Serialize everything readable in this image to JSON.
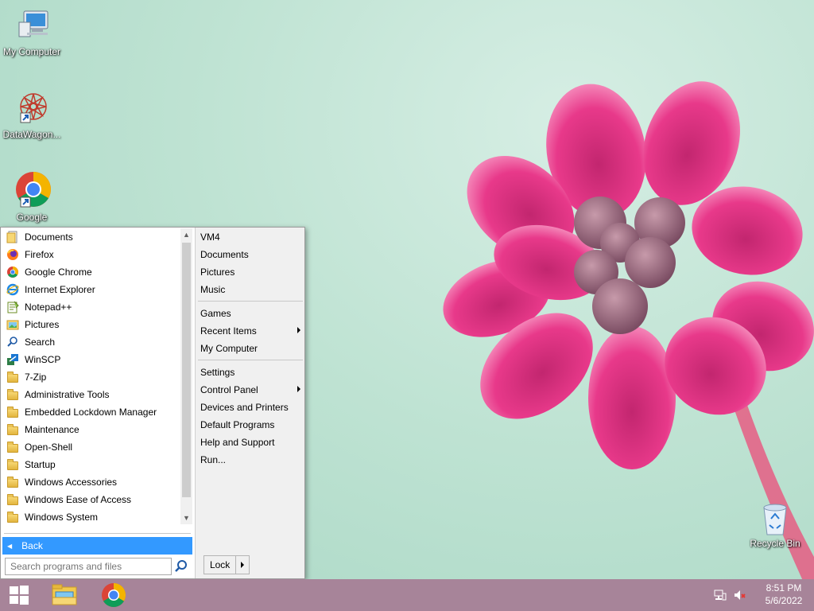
{
  "desktop": {
    "icons": [
      {
        "label": "My Computer",
        "icon": "computer-icon"
      },
      {
        "label": "DataWagon...",
        "icon": "datawagon-icon"
      },
      {
        "label": "Google",
        "icon": "chrome-icon"
      },
      {
        "label": "Recycle Bin",
        "icon": "recycle-bin-icon"
      }
    ]
  },
  "start_menu": {
    "programs": [
      {
        "label": "Documents",
        "icon": "documents-icon"
      },
      {
        "label": "Firefox",
        "icon": "firefox-icon"
      },
      {
        "label": "Google Chrome",
        "icon": "chrome-icon"
      },
      {
        "label": "Internet Explorer",
        "icon": "internet-explorer-icon"
      },
      {
        "label": "Notepad++",
        "icon": "notepad-plus-plus-icon"
      },
      {
        "label": "Pictures",
        "icon": "pictures-icon"
      },
      {
        "label": "Search",
        "icon": "search-icon"
      },
      {
        "label": "WinSCP",
        "icon": "winscp-icon"
      },
      {
        "label": "7-Zip",
        "icon": "folder-icon"
      },
      {
        "label": "Administrative Tools",
        "icon": "folder-icon"
      },
      {
        "label": "Embedded Lockdown Manager",
        "icon": "folder-icon"
      },
      {
        "label": "Maintenance",
        "icon": "folder-icon"
      },
      {
        "label": "Open-Shell",
        "icon": "folder-icon"
      },
      {
        "label": "Startup",
        "icon": "folder-icon"
      },
      {
        "label": "Windows Accessories",
        "icon": "folder-icon"
      },
      {
        "label": "Windows Ease of Access",
        "icon": "folder-icon"
      },
      {
        "label": "Windows System",
        "icon": "folder-icon"
      }
    ],
    "back_label": "Back",
    "search_placeholder": "Search programs and files",
    "right_items": [
      {
        "label": "VM4"
      },
      {
        "label": "Documents"
      },
      {
        "label": "Pictures"
      },
      {
        "label": "Music"
      },
      {
        "label": "Games"
      },
      {
        "label": "Recent Items",
        "submenu": true
      },
      {
        "label": "My Computer"
      },
      {
        "label": "Settings"
      },
      {
        "label": "Control Panel",
        "submenu": true
      },
      {
        "label": "Devices and Printers"
      },
      {
        "label": "Default Programs"
      },
      {
        "label": "Help and Support"
      },
      {
        "label": "Run..."
      }
    ],
    "lock_label": "Lock"
  },
  "taskbar": {
    "buttons": [
      "start-button",
      "file-explorer-button",
      "chrome-button"
    ],
    "tray_icons": [
      "network-icon",
      "volume-muted-icon"
    ],
    "time": "8:51 PM",
    "date": "5/6/2022"
  },
  "colors": {
    "taskbar": "#a78499",
    "highlight": "#3399ff",
    "wallpaper": "#bfe3d3"
  }
}
